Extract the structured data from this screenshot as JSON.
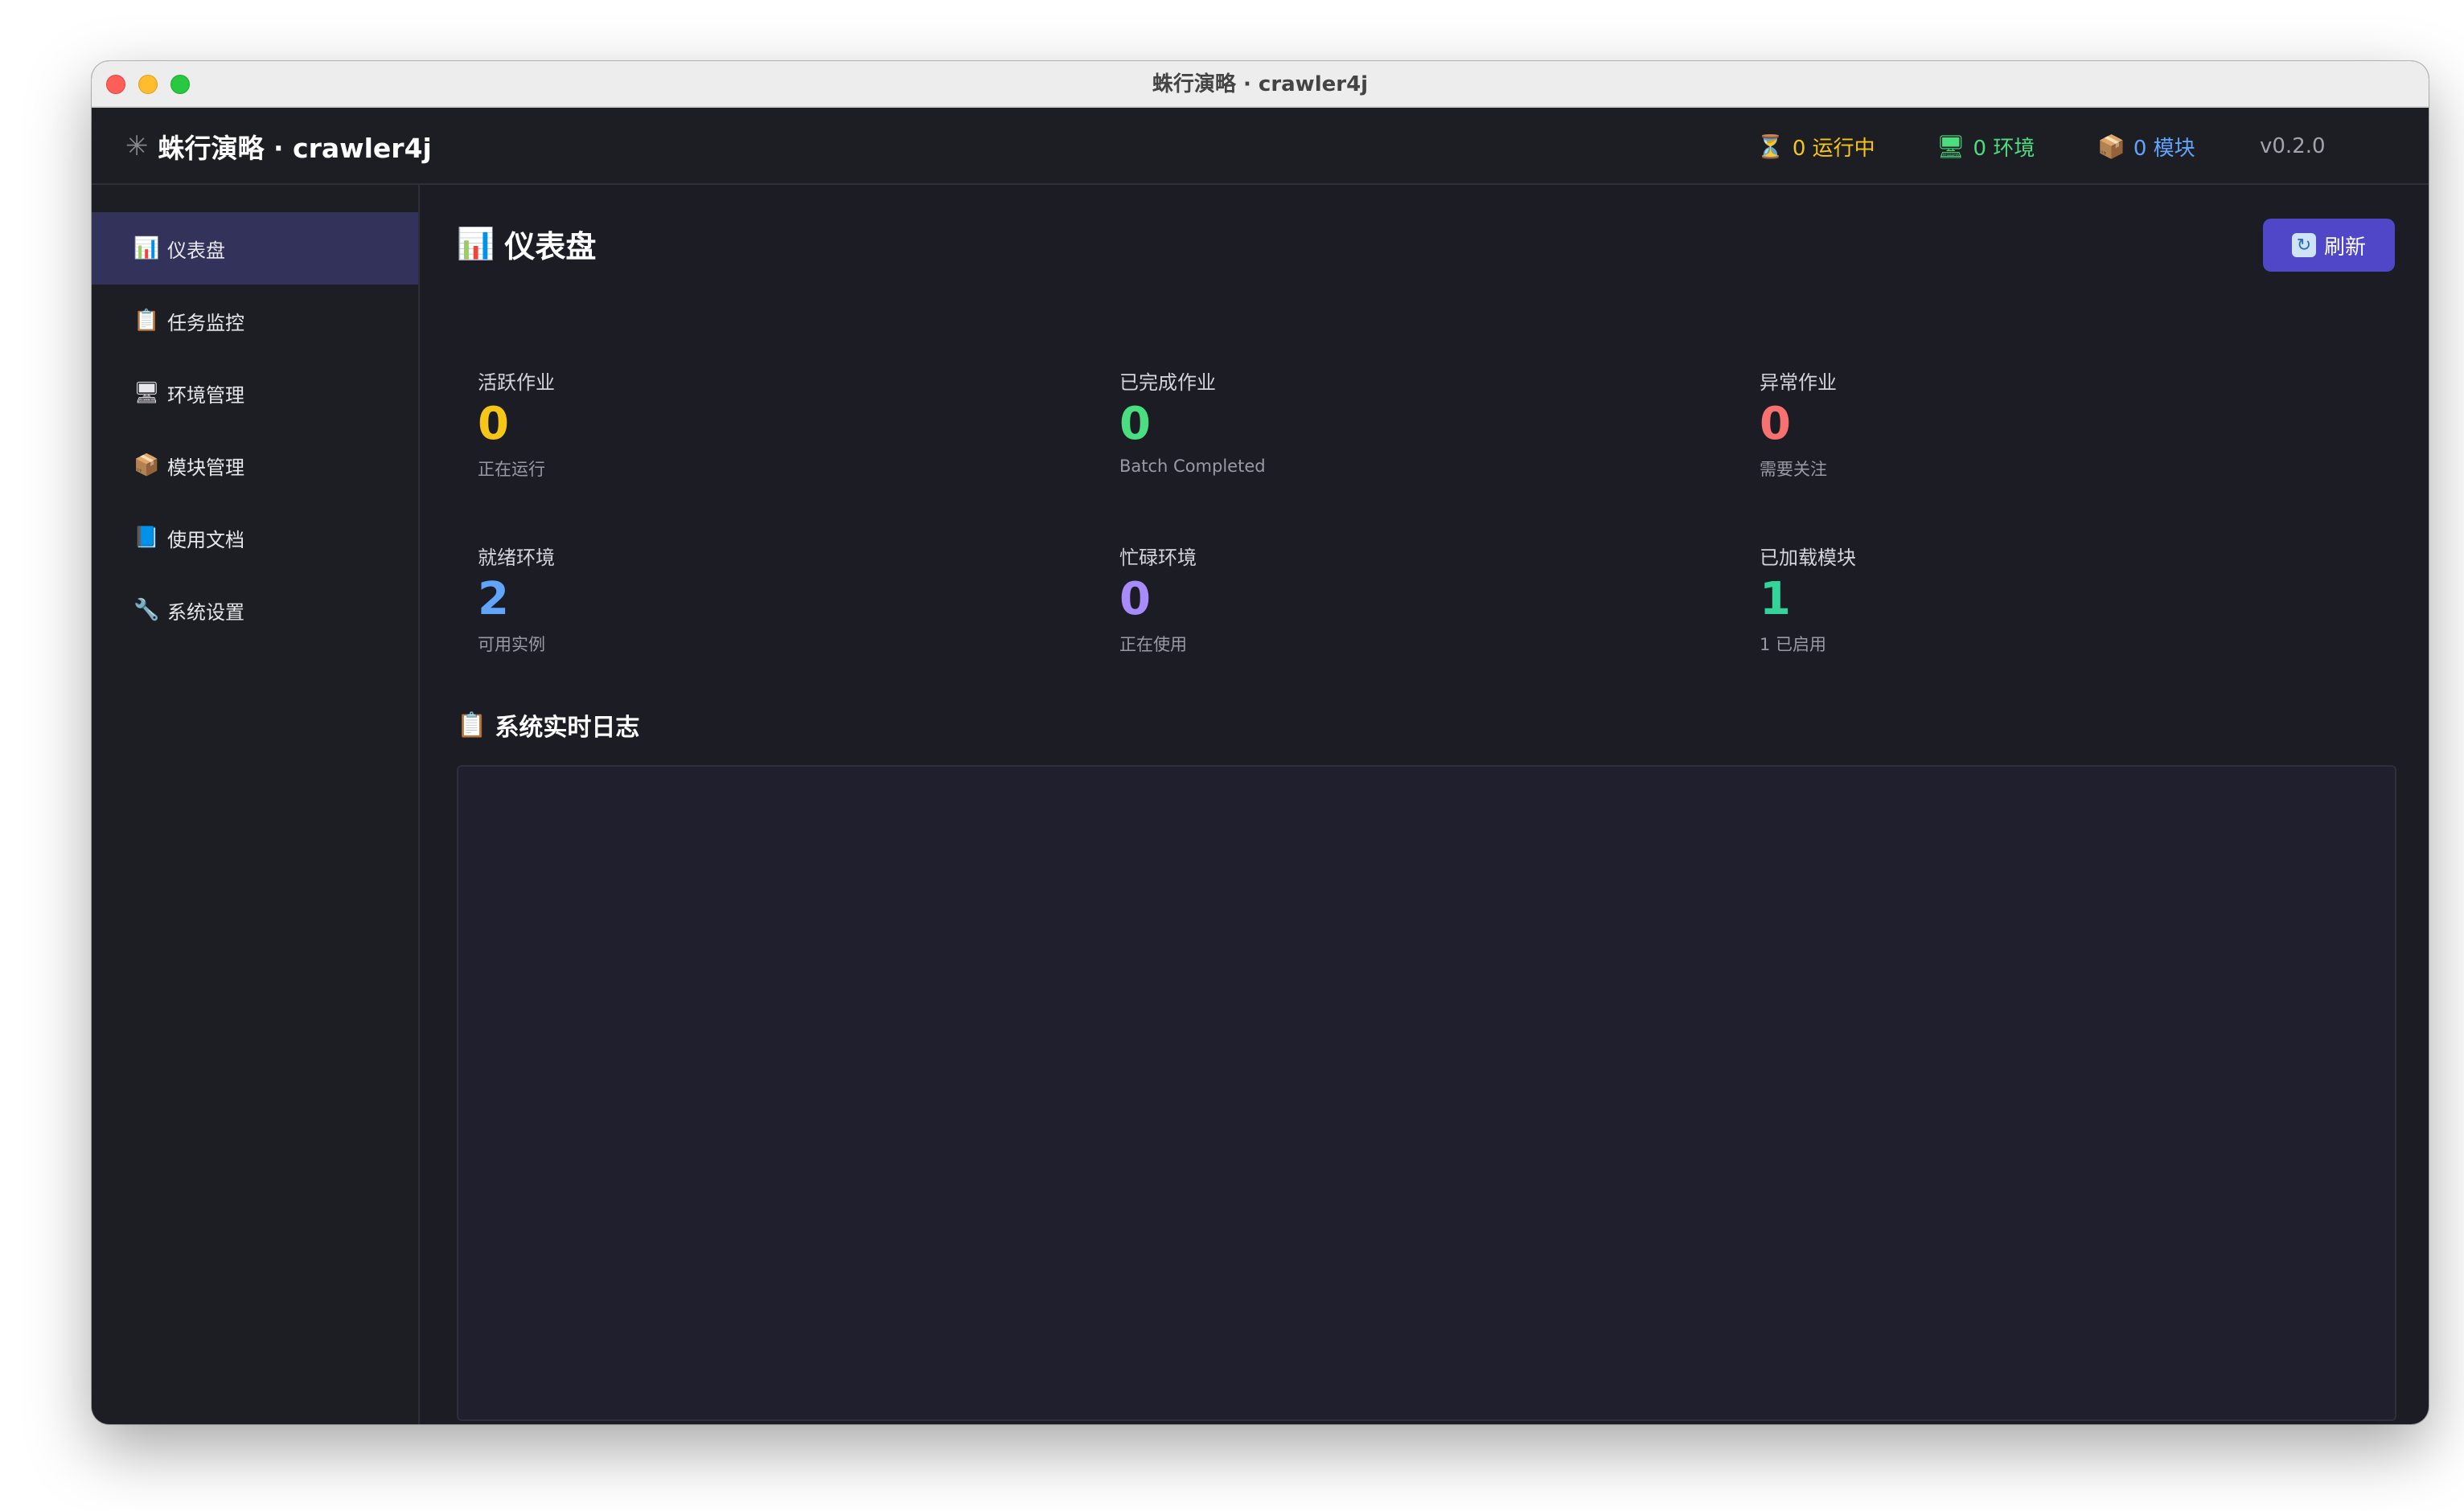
{
  "window": {
    "title": "蛛行演略 · crawler4j"
  },
  "appbar": {
    "brand_icon": "spider-icon",
    "brand": "蛛行演略 · crawler4j",
    "status": [
      {
        "icon": "hourglass-icon",
        "label": "0 运行中",
        "color": "#f5c518"
      },
      {
        "icon": "monitor-icon",
        "label": "0 环境",
        "color": "#4ade80"
      },
      {
        "icon": "package-icon",
        "label": "0 模块",
        "color": "#60a5fa"
      }
    ],
    "version": "v0.2.0"
  },
  "sidebar": {
    "items": [
      {
        "icon": "bar-chart-icon",
        "label": "仪表盘",
        "active": true
      },
      {
        "icon": "clipboard-icon",
        "label": "任务监控"
      },
      {
        "icon": "monitor-icon",
        "label": "环境管理"
      },
      {
        "icon": "package-icon",
        "label": "模块管理"
      },
      {
        "icon": "book-icon",
        "label": "使用文档"
      },
      {
        "icon": "wrench-icon",
        "label": "系统设置"
      }
    ]
  },
  "main": {
    "title": "仪表盘",
    "title_icon": "bar-chart-icon",
    "refresh_label": "刷新",
    "refresh_icon": "refresh-icon",
    "stats": [
      {
        "label": "活跃作业",
        "value": "0",
        "sub": "正在运行",
        "color": "#f5c518"
      },
      {
        "label": "已完成作业",
        "value": "0",
        "sub": "Batch Completed",
        "color": "#4ade80"
      },
      {
        "label": "异常作业",
        "value": "0",
        "sub": "需要关注",
        "color": "#f87171"
      },
      {
        "label": "就绪环境",
        "value": "2",
        "sub": "可用实例",
        "color": "#60a5fa"
      },
      {
        "label": "忙碌环境",
        "value": "0",
        "sub": "正在使用",
        "color": "#a78bfa"
      },
      {
        "label": "已加载模块",
        "value": "1",
        "sub": "1 已启用",
        "color": "#34d399"
      }
    ],
    "log_title": "系统实时日志",
    "log_icon": "clipboard-icon"
  },
  "colors": {
    "accent": "#4f46c8",
    "sidebar_active": "#32325a",
    "background": "#1c1c24"
  }
}
